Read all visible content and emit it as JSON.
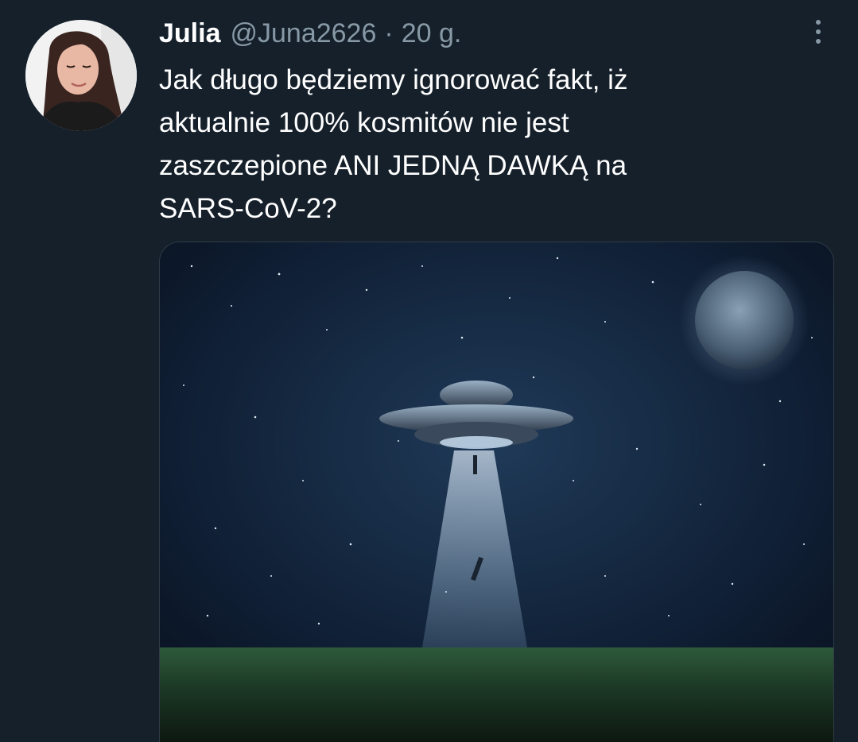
{
  "tweet": {
    "author_name": "Julia",
    "author_handle": "@Juna2626",
    "separator": "·",
    "timestamp": "20 g.",
    "text_lines": [
      "Jak długo będziemy ignorować fakt, iż",
      "aktualnie 100% kosmitów nie jest",
      "zaszczepione ANI JEDNĄ DAWKĄ na",
      "SARS-CoV-2?"
    ]
  },
  "icons": {
    "more": "more-options-icon"
  },
  "colors": {
    "background": "#15202b",
    "text": "#ffffff",
    "muted": "#8899a6"
  }
}
